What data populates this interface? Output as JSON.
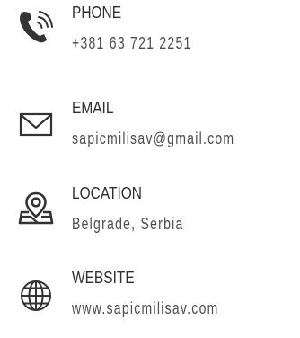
{
  "contacts": {
    "phone": {
      "icon": "phone-icon",
      "label": "PHONE",
      "value": "+381 63 721 2251"
    },
    "email": {
      "icon": "envelope-icon",
      "label": "EMAIL",
      "value": "sapicmilisav@gmail.com"
    },
    "location": {
      "icon": "map-pin-icon",
      "label": "LOCATION",
      "value": "Belgrade, Serbia"
    },
    "website": {
      "icon": "globe-icon",
      "label": "WEBSITE",
      "value": "www.sapicmilisav.com"
    }
  },
  "colors": {
    "icon": "#333333",
    "label": "#2e2e2e",
    "value": "#4d4d4d",
    "background": "#ffffff"
  }
}
